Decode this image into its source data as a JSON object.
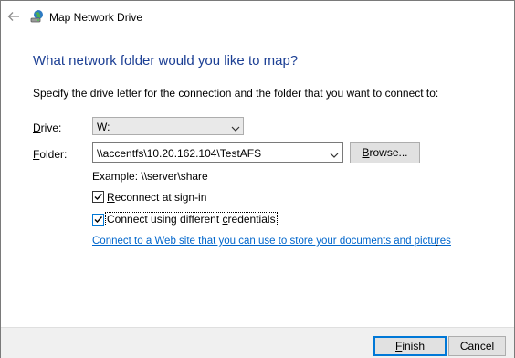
{
  "window": {
    "title": "Map Network Drive"
  },
  "heading": "What network folder would you like to map?",
  "instruction": "Specify the drive letter for the connection and the folder that you want to connect to:",
  "drive": {
    "label_accel": "D",
    "label_rest": "rive:",
    "value": "W:"
  },
  "folder": {
    "label_accel": "F",
    "label_rest": "older:",
    "value": "\\\\accentfs\\10.20.162.104\\TestAFS",
    "browse_accel": "B",
    "browse_rest": "rowse..."
  },
  "example": "Example: \\\\server\\share",
  "reconnect": {
    "accel": "R",
    "rest": "econnect at sign-in",
    "checked": true
  },
  "credentials": {
    "pre": "Connect using different ",
    "accel": "c",
    "rest": "redentials",
    "checked": true
  },
  "link": {
    "text": "Connect to a Web site that you can use to store your documents and pictures",
    "suffix": "."
  },
  "buttons": {
    "finish_accel": "F",
    "finish_rest": "inish",
    "cancel": "Cancel"
  },
  "icons": {
    "back": "back-arrow-icon",
    "app": "network-drive-icon",
    "chevron": "chevron-down-icon",
    "check": "checkmark-icon"
  },
  "colors": {
    "heading": "#1c3f94",
    "link": "#0066cc",
    "accent": "#0078d7"
  }
}
